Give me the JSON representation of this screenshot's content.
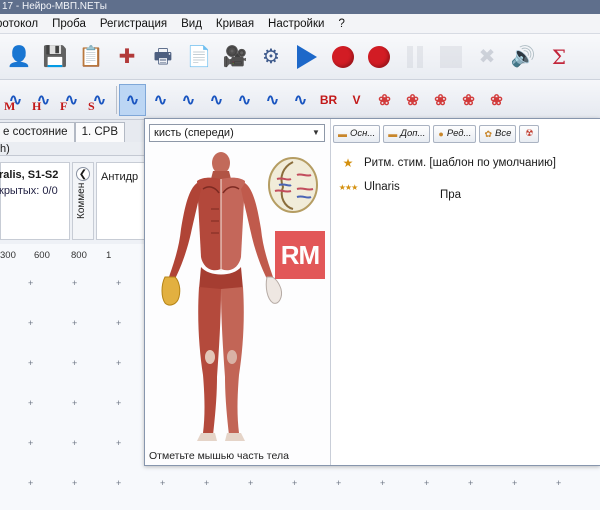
{
  "window": {
    "title": "17 - Нейро-МВП.NETы"
  },
  "menu": [
    "ротокол",
    "Проба",
    "Регистрация",
    "Вид",
    "Кривая",
    "Настройки",
    "?"
  ],
  "toolbar_main": [
    {
      "icon": "patient-icon"
    },
    {
      "icon": "save-icon"
    },
    {
      "icon": "protocol-icon"
    },
    {
      "icon": "add-icon"
    },
    {
      "icon": "print-icon"
    },
    {
      "icon": "report-icon"
    },
    {
      "icon": "video-icon"
    },
    {
      "icon": "settings-icon"
    },
    {
      "icon": "play-icon"
    },
    {
      "icon": "record-icon"
    },
    {
      "icon": "record-stop-icon"
    },
    {
      "icon": "pause-icon"
    },
    {
      "icon": "stop-icon"
    },
    {
      "icon": "delete-icon"
    },
    {
      "icon": "volume-icon"
    },
    {
      "icon": "sigma-icon"
    }
  ],
  "toolbar_tests": [
    {
      "label": "M"
    },
    {
      "label": "H"
    },
    {
      "label": "F"
    },
    {
      "label": "S"
    },
    {
      "label": ""
    },
    {
      "label": ""
    },
    {
      "label": ""
    },
    {
      "label": ""
    },
    {
      "label": ""
    },
    {
      "label": ""
    },
    {
      "label": ""
    },
    {
      "label": "BR"
    },
    {
      "label": "V"
    },
    {
      "label": ""
    },
    {
      "label": ""
    },
    {
      "label": ""
    },
    {
      "label": ""
    },
    {
      "label": ""
    }
  ],
  "background": {
    "tabs": [
      "е состояние",
      "1. СРВ"
    ],
    "strip": "h)",
    "info_title": "ralis, S1-S2",
    "info_sub": "крытых: 0/0",
    "comment_label": "Коммен",
    "anti_label": "Антидр",
    "axis_ticks": [
      "300",
      "600",
      "800",
      "1"
    ]
  },
  "dialog": {
    "region_select": "кисть (спереди)",
    "hint": "Отметьте мышью часть тела",
    "buttons": [
      "Осн...",
      "Доп...",
      "Ред...",
      "Все"
    ],
    "templates": [
      {
        "name": "Ритм. стим. [шаблон по умолчанию]"
      },
      {
        "name": "Ulnaris"
      }
    ],
    "side_text": "Пра"
  },
  "watermark": "RM",
  "colors": {
    "accent": "#1d68c9",
    "record": "#d21c24",
    "title_bar": "#5f6f8c",
    "dialog_border": "#8796ad",
    "watermark": "#e04a4a"
  }
}
